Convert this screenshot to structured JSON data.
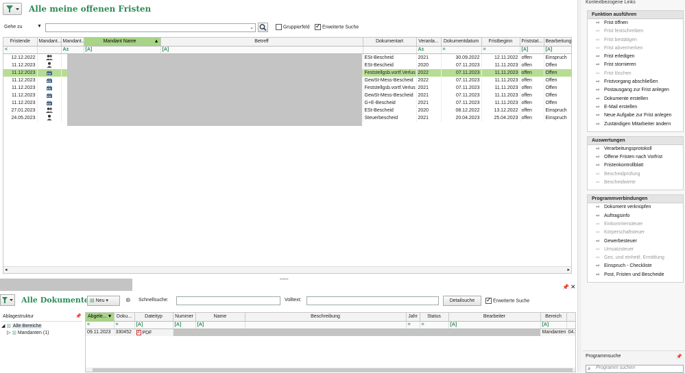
{
  "top_panel": {
    "title": "Alle meine offenen Fristen",
    "goto_label": "Gehe zu",
    "gruppierfeld_label": "Gruppierfeld",
    "erweiterte_suche_label": "Erweiterte Suche",
    "columns": [
      "Fristende",
      "Mandant...",
      "Mandant...",
      "Mandant Name",
      "Betreff",
      "Dokumentart",
      "Veranla...",
      "Dokumentdatum",
      "Fristbeginn",
      "Friststat...",
      "Bearbeitungss"
    ],
    "filter_row": [
      "<",
      "",
      "A±",
      "[A]",
      "[A]",
      "",
      "A±",
      "=",
      "=",
      "[A]",
      "[A]"
    ],
    "rows": [
      {
        "fristende": "12.12.2022",
        "dokumentart": "ESt-Bescheid",
        "veranlagung": "2021",
        "dokumentdatum": "30.09.2022",
        "fristbeginn": "12.11.2022",
        "status": "offen",
        "bearbeitung": "Einspruch",
        "icon": "group-icon",
        "selected": false
      },
      {
        "fristende": "11.12.2023",
        "dokumentart": "ESt-Bescheid",
        "veranlagung": "2020",
        "dokumentdatum": "07.11.2023",
        "fristbeginn": "11.11.2023",
        "status": "offen",
        "bearbeitung": "Offen",
        "icon": "person-icon",
        "selected": false
      },
      {
        "fristende": "11.12.2023",
        "dokumentart": "Feststellgsb.vortf.Verlus",
        "veranlagung": "2022",
        "dokumentdatum": "07.11.2023",
        "fristbeginn": "11.11.2023",
        "status": "offen",
        "bearbeitung": "Offen",
        "icon": "factory-icon",
        "selected": true
      },
      {
        "fristende": "11.12.2023",
        "dokumentart": "GewSt-Mess-Bescheid",
        "veranlagung": "2022",
        "dokumentdatum": "07.11.2023",
        "fristbeginn": "11.11.2023",
        "status": "offen",
        "bearbeitung": "Offen",
        "icon": "factory-icon",
        "selected": false
      },
      {
        "fristende": "11.12.2023",
        "dokumentart": "Feststellgsb.vortf.Verlus",
        "veranlagung": "2021",
        "dokumentdatum": "07.11.2023",
        "fristbeginn": "11.11.2023",
        "status": "offen",
        "bearbeitung": "Offen",
        "icon": "factory-icon",
        "selected": false
      },
      {
        "fristende": "11.12.2023",
        "dokumentart": "GewSt-Mess-Bescheid",
        "veranlagung": "2021",
        "dokumentdatum": "07.11.2023",
        "fristbeginn": "11.11.2023",
        "status": "offen",
        "bearbeitung": "Offen",
        "icon": "factory-icon",
        "selected": false
      },
      {
        "fristende": "11.12.2023",
        "dokumentart": "G+E-Bescheid",
        "veranlagung": "2021",
        "dokumentdatum": "07.11.2023",
        "fristbeginn": "11.11.2023",
        "status": "offen",
        "bearbeitung": "Offen",
        "icon": "factory-icon",
        "selected": false
      },
      {
        "fristende": "27.01.2023",
        "dokumentart": "ESt-Bescheid",
        "veranlagung": "2020",
        "dokumentdatum": "08.12.2022",
        "fristbeginn": "13.12.2022",
        "status": "offen",
        "bearbeitung": "Einspruch",
        "icon": "group-icon",
        "selected": false
      },
      {
        "fristende": "24.05.2023",
        "dokumentart": "Steuerbescheid",
        "veranlagung": "2021",
        "dokumentdatum": "20.04.2023",
        "fristbeginn": "25.04.2023",
        "status": "offen",
        "bearbeitung": "Einspruch",
        "icon": "person-icon",
        "selected": false
      }
    ]
  },
  "bottom_panel": {
    "title": "Alle Dokumente",
    "neu_label": "Neu",
    "schnellsuche_label": "Schnellsuche:",
    "volltext_label": "Volltext:",
    "detailsuche_label": "Detailsuche",
    "erweiterte_suche_label": "Erweiterte Suche",
    "tree_header": "Ablagestruktur",
    "tree_items": [
      "Alle Bereiche",
      "Mandanten (1)"
    ],
    "columns": [
      "Abgele...",
      "Doku...",
      "Dateityp",
      "Nummer",
      "Name",
      "Beschreibung",
      "Jahr",
      "Status",
      "Bearbeiter",
      "Bereich"
    ],
    "filter_row": [
      "=",
      "=",
      "[A]",
      "[A]",
      "[A]",
      "",
      "=",
      "=",
      "[A]",
      "[A]"
    ],
    "row": {
      "abgelegt": "09.11.2023",
      "doku": "330452",
      "dateityp": "PDF",
      "bereich": "Mandanten",
      "extra": "04.S"
    }
  },
  "sidebar": {
    "top_label": "Kontextbezogene Links",
    "sections": [
      {
        "title": "Funktion ausführen",
        "items": [
          {
            "label": "Frist öffnen",
            "enabled": true
          },
          {
            "label": "Frist festschreiben",
            "enabled": false
          },
          {
            "label": "Frist bestätigen",
            "enabled": false
          },
          {
            "label": "Frist abvermerken",
            "enabled": false
          },
          {
            "label": "Frist erledigen",
            "enabled": true
          },
          {
            "label": "Frist stornieren",
            "enabled": true
          },
          {
            "label": "Frist löschen",
            "enabled": false
          },
          {
            "label": "Fristvorgang abschließen",
            "enabled": true
          },
          {
            "label": "Postausgang zur Frist anlegen",
            "enabled": true
          },
          {
            "label": "Dokumente erstellen",
            "enabled": true
          },
          {
            "label": "E-Mail erstellen",
            "enabled": true
          },
          {
            "label": "Neue Aufgabe zur Frist anlegen",
            "enabled": true
          },
          {
            "label": "Zuständigen Mitarbeiter ändern",
            "enabled": true
          }
        ]
      },
      {
        "title": "Auswertungen",
        "items": [
          {
            "label": "Verarbeitungsprotokoll",
            "enabled": true
          },
          {
            "label": "Offene Fristen nach Vorfrist",
            "enabled": true
          },
          {
            "label": "Fristenkontrollblatt",
            "enabled": true
          },
          {
            "label": "Bescheidprüfung",
            "enabled": false
          },
          {
            "label": "Bescheidwerte",
            "enabled": false
          }
        ]
      },
      {
        "title": "Programmverbindungen",
        "items": [
          {
            "label": "Dokument verknüpfen",
            "enabled": true
          },
          {
            "label": "Auftragsinfo",
            "enabled": true
          },
          {
            "label": "Einkommensteuer",
            "enabled": false
          },
          {
            "label": "Körperschaftsteuer",
            "enabled": false
          },
          {
            "label": "Gewerbesteuer",
            "enabled": true
          },
          {
            "label": "Umsatzsteuer",
            "enabled": false
          },
          {
            "label": "Ges. und einheitl. Ermittlung",
            "enabled": false
          },
          {
            "label": "Einspruch - Checkliste",
            "enabled": true
          },
          {
            "label": "Post, Fristen und Bescheide",
            "enabled": true
          }
        ]
      }
    ],
    "programmsuche_label": "Programmsuche",
    "programmsuche_placeholder": "Programm suchen"
  }
}
